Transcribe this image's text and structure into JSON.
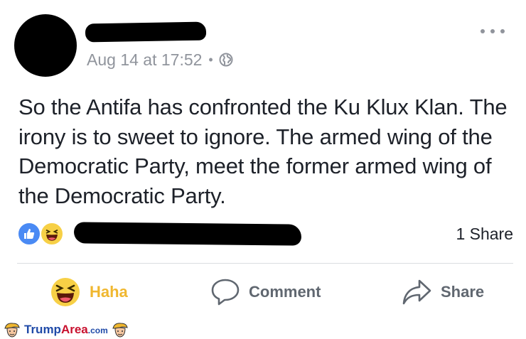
{
  "post": {
    "timestamp": "Aug 14 at 17:52",
    "separator": "•",
    "privacy_icon": "globe-icon",
    "body": "So the Antifa has confronted the Ku Klux Klan. The irony is to sweet to ignore.  The armed wing of the Democratic Party, meet the former armed wing of the Democratic Party."
  },
  "reactions": {
    "icons": [
      "like-icon",
      "haha-icon"
    ],
    "share_count": "1 Share"
  },
  "actions": {
    "haha_label": "Haha",
    "comment_label": "Comment",
    "share_label": "Share"
  },
  "watermark": {
    "brand_part1": "Trump",
    "brand_part2": "Area",
    "brand_suffix": ".com"
  },
  "colors": {
    "secondary_text": "#90949c",
    "haha_active": "#f0b72f",
    "like_blue": "#4a8af4",
    "action_gray": "#606770"
  }
}
